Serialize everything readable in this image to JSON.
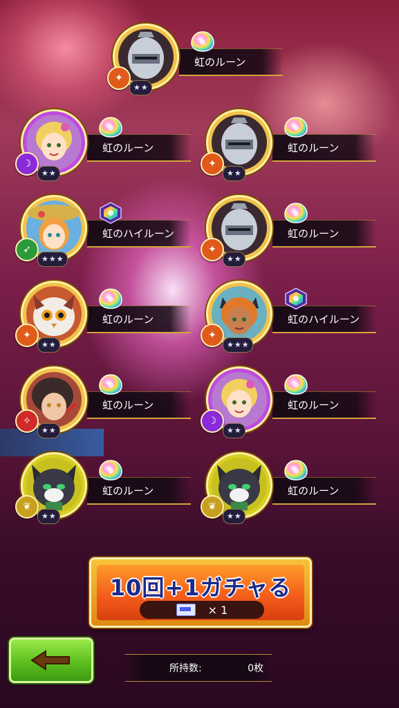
{
  "results": [
    {
      "id": "r1",
      "rune": "虹のルーン",
      "rune_type": "rune",
      "char": "knight",
      "class": "bow",
      "class_color": "#e05a1a",
      "stars": 2,
      "frame": "#f2c24a"
    },
    {
      "id": "r2",
      "rune": "虹のルーン",
      "rune_type": "rune",
      "char": "blonde-girl",
      "class": "staff",
      "class_color": "#8a2ad8",
      "stars": 2,
      "frame": "#c04ae0"
    },
    {
      "id": "r3",
      "rune": "虹のルーン",
      "rune_type": "rune",
      "char": "knight",
      "class": "bow",
      "class_color": "#e05a1a",
      "stars": 2,
      "frame": "#f2c24a"
    },
    {
      "id": "r4",
      "rune": "虹のハイルーン",
      "rune_type": "high",
      "char": "hat-girl",
      "class": "spear",
      "class_color": "#2a9a3a",
      "stars": 3,
      "frame": "#f2c24a"
    },
    {
      "id": "r5",
      "rune": "虹のルーン",
      "rune_type": "rune",
      "char": "knight",
      "class": "bow",
      "class_color": "#e05a1a",
      "stars": 2,
      "frame": "#f2c24a"
    },
    {
      "id": "r6",
      "rune": "虹のルーン",
      "rune_type": "rune",
      "char": "owl-cat",
      "class": "bow",
      "class_color": "#e05a1a",
      "stars": 2,
      "frame": "#f2c24a"
    },
    {
      "id": "r7",
      "rune": "虹のハイルーン",
      "rune_type": "high",
      "char": "cat-girl",
      "class": "bow",
      "class_color": "#e05a1a",
      "stars": 3,
      "frame": "#f2c24a"
    },
    {
      "id": "r8",
      "rune": "虹のルーン",
      "rune_type": "rune",
      "char": "dark-hair",
      "class": "sword",
      "class_color": "#d02a2a",
      "stars": 2,
      "frame": "#f2c24a"
    },
    {
      "id": "r9",
      "rune": "虹のルーン",
      "rune_type": "rune",
      "char": "blonde-girl",
      "class": "staff",
      "class_color": "#8a2ad8",
      "stars": 2,
      "frame": "#c04ae0"
    },
    {
      "id": "r10",
      "rune": "虹のルーン",
      "rune_type": "rune",
      "char": "black-cat",
      "class": "leaf",
      "class_color": "#c8a020",
      "stars": 2,
      "frame": "#d8d020"
    },
    {
      "id": "r11",
      "rune": "虹のルーン",
      "rune_type": "rune",
      "char": "black-cat",
      "class": "leaf",
      "class_color": "#c8a020",
      "stars": 2,
      "frame": "#d8d020"
    }
  ],
  "gacha": {
    "label": "10回+1ガチャる",
    "ticket_count": "× 1"
  },
  "owned": {
    "label": "所持数:",
    "value": "0枚"
  },
  "icons": {
    "back": "back-arrow-icon",
    "ticket": "ticket-icon"
  }
}
